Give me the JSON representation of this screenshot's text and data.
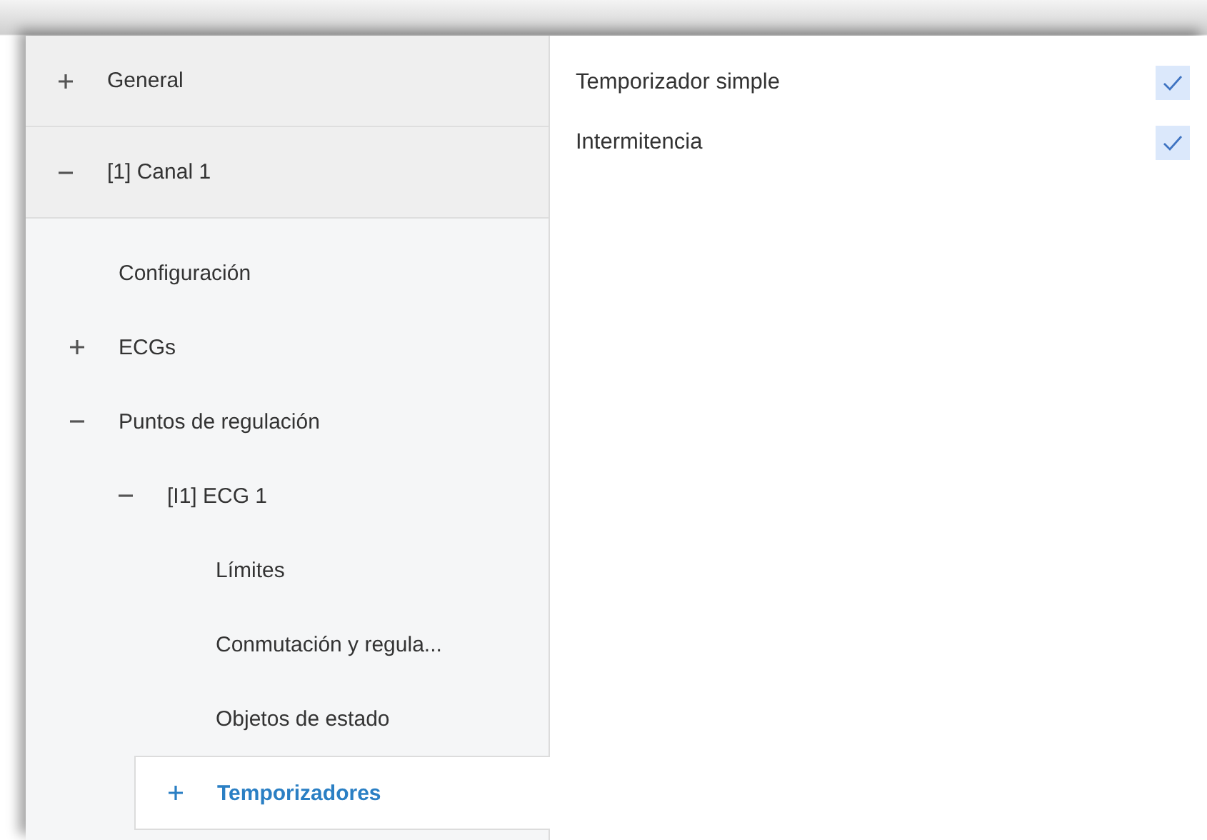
{
  "sidebar": {
    "sections": [
      {
        "label": "General",
        "expanded": false,
        "selected": false
      },
      {
        "label": "[1] Canal 1",
        "expanded": true,
        "selected": false,
        "children": [
          {
            "label": "Configuración",
            "kind": "leaf",
            "selected": false
          },
          {
            "label": "ECGs",
            "kind": "group",
            "expanded": false,
            "selected": false
          },
          {
            "label": "Puntos de regulación",
            "kind": "group",
            "expanded": true,
            "selected": false,
            "children": [
              {
                "label": "[I1] ECG 1",
                "kind": "group",
                "expanded": true,
                "selected": false,
                "children": [
                  {
                    "label": "Límites",
                    "kind": "leaf",
                    "selected": false
                  },
                  {
                    "label": "Conmutación y regula...",
                    "kind": "leaf",
                    "selected": false
                  },
                  {
                    "label": "Objetos de estado",
                    "kind": "leaf",
                    "selected": false
                  },
                  {
                    "label": "Temporizadores",
                    "kind": "group",
                    "expanded": false,
                    "selected": true
                  }
                ]
              }
            ]
          }
        ]
      }
    ]
  },
  "options": [
    {
      "label": "Temporizador simple",
      "checked": true
    },
    {
      "label": "Intermitencia",
      "checked": true
    }
  ]
}
